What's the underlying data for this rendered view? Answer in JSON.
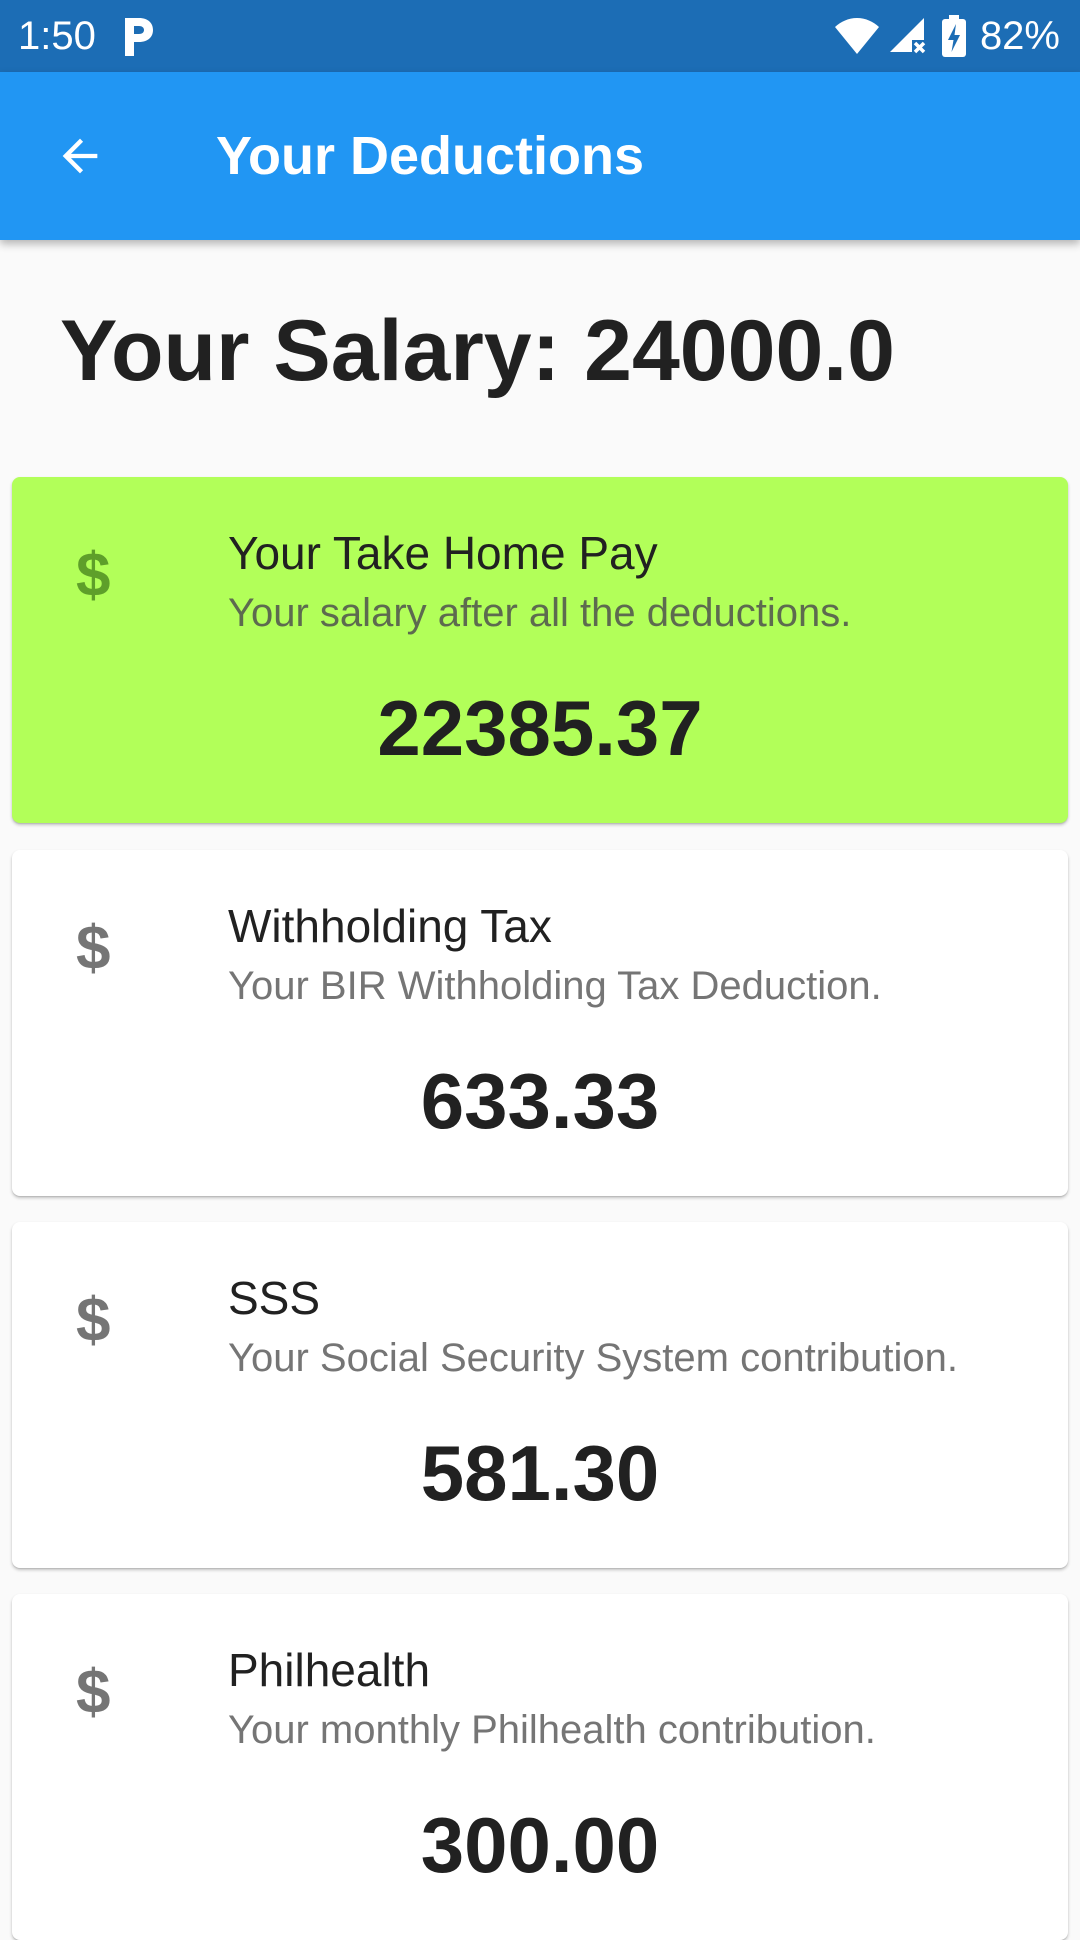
{
  "status_bar": {
    "time": "1:50",
    "battery": "82%",
    "icons": [
      "parking-p-icon",
      "wifi-icon",
      "cell-signal-no-service-icon",
      "battery-charging-icon"
    ]
  },
  "app_bar": {
    "title": "Your Deductions",
    "back_icon": "arrow-back-icon",
    "background_color": "#2196f3"
  },
  "salary": {
    "text": "Your Salary: 24000.0"
  },
  "cards": [
    {
      "icon": "$",
      "title": "Your Take Home Pay",
      "subtitle": "Your salary after all the deductions.",
      "amount": "22385.37",
      "background_color": "#b2ff59"
    },
    {
      "icon": "$",
      "title": "Withholding Tax",
      "subtitle": "Your BIR Withholding Tax Deduction.",
      "amount": "633.33",
      "background_color": "#ffffff"
    },
    {
      "icon": "$",
      "title": "SSS",
      "subtitle": "Your Social Security System contribution.",
      "amount": "581.30",
      "background_color": "#ffffff"
    },
    {
      "icon": "$",
      "title": "Philhealth",
      "subtitle": "Your monthly Philhealth contribution.",
      "amount": "300.00",
      "background_color": "#ffffff"
    }
  ]
}
